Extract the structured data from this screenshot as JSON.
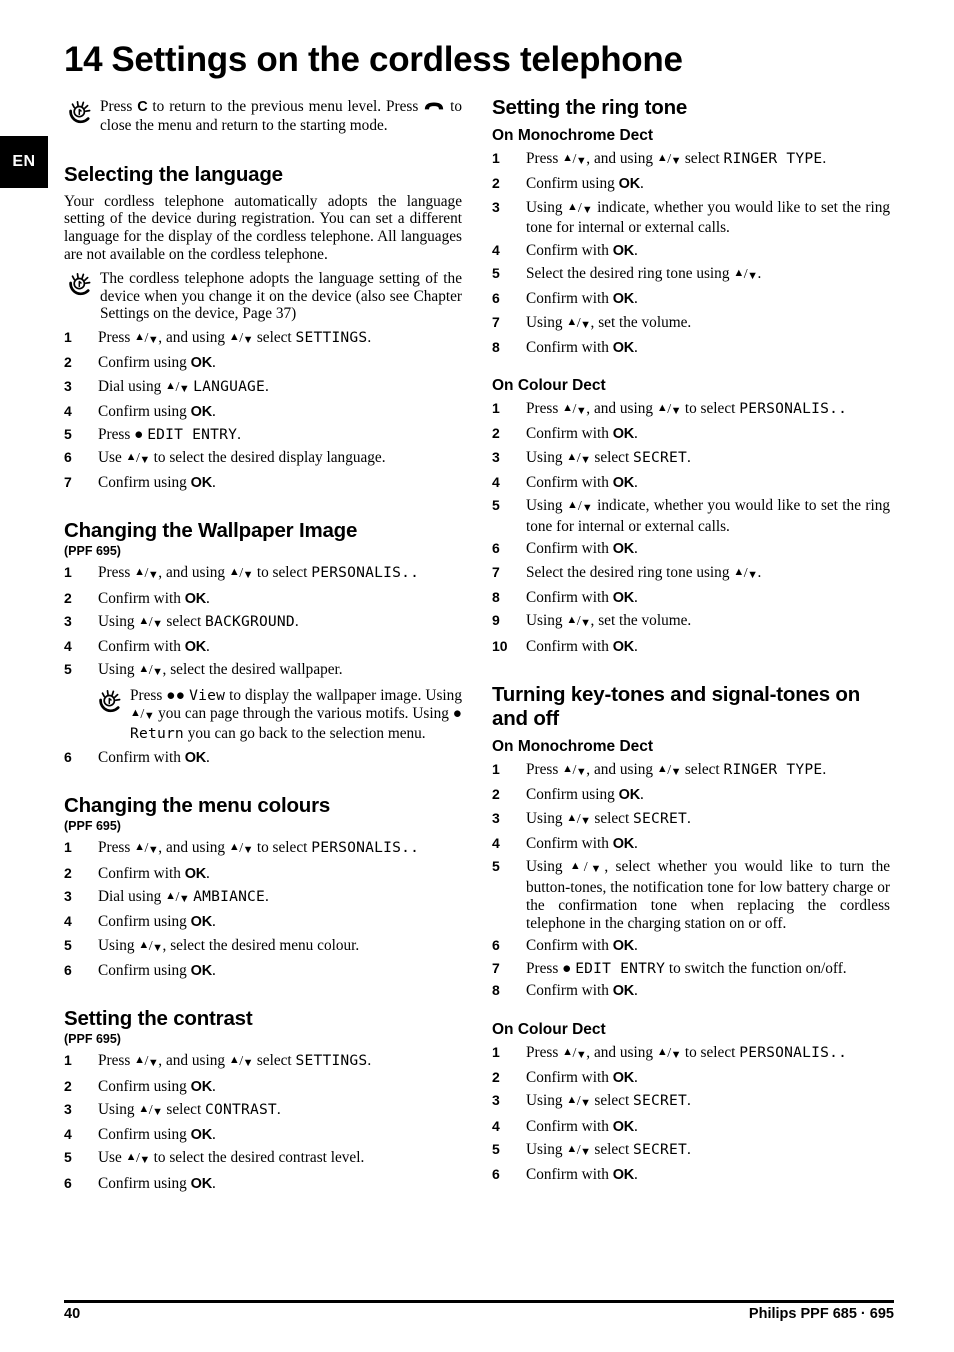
{
  "page": {
    "language_tab": "EN",
    "chapter_number": "14",
    "chapter_title": "Settings on the cordless telephone",
    "footer_page_number": "40",
    "footer_product": "Philips PPF 685 · 695"
  },
  "intro_hint": {
    "text_1": "Press ",
    "key_c": "C",
    "text_2": " to return to the previous menu level. Press ",
    "text_3": " to close the menu and return to the starting mode."
  },
  "left_column": {
    "selecting_language": {
      "heading": "Selecting the language",
      "body": "Your cordless telephone automatically adopts the language setting of the device during registration. You can set a different language for the display of the cordless telephone. All languages are not available on the cordless telephone.",
      "hint": "The cordless telephone adopts the language setting of the device when you change it on the device (also see Chapter Settings on the device, Page 37)",
      "steps": [
        {
          "n": "1",
          "pre": "Press ",
          "mid": ", and using ",
          "post": " select ",
          "lcd": "SETTINGS",
          "tail": "."
        },
        {
          "n": "2",
          "plain_pre": "Confirm using ",
          "key": "OK",
          "tail": "."
        },
        {
          "n": "3",
          "pre": "Dial using ",
          "post": " ",
          "lcd": "LANGUAGE",
          "tail": "."
        },
        {
          "n": "4",
          "plain_pre": "Confirm using ",
          "key": "OK",
          "tail": "."
        },
        {
          "n": "5",
          "plain_pre": "Press ● ",
          "lcd": "EDIT ENTRY",
          "tail": "."
        },
        {
          "n": "6",
          "pre": "Use ",
          "post": " to select the desired display language."
        },
        {
          "n": "7",
          "plain_pre": "Confirm using ",
          "key": "OK",
          "tail": "."
        }
      ]
    },
    "wallpaper": {
      "heading": "Changing the Wallpaper Image",
      "model": "(PPF 695)",
      "steps": [
        {
          "n": "1",
          "pre": "Press ",
          "mid": ", and using ",
          "post": " to select ",
          "lcd": "PERSONALIS..",
          "tail": ""
        },
        {
          "n": "2",
          "plain_pre": "Confirm with ",
          "key": "OK",
          "tail": "."
        },
        {
          "n": "3",
          "pre": "Using ",
          "post": " select ",
          "lcd": "BACKGROUND",
          "tail": "."
        },
        {
          "n": "4",
          "plain_pre": "Confirm with ",
          "key": "OK",
          "tail": "."
        },
        {
          "n": "5",
          "pre": "Using ",
          "post": ", select the desired wallpaper."
        }
      ],
      "hint_1": "Press ●● ",
      "hint_lcd_1": "View",
      "hint_2": " to display the wallpaper image. Using ",
      "hint_3": " you can page through the various motifs. Using ● ",
      "hint_lcd_2": "Return",
      "hint_4": " you can go back to the selection menu.",
      "final_step": {
        "n": "6",
        "plain_pre": "Confirm with ",
        "key": "OK",
        "tail": "."
      }
    },
    "menu_colours": {
      "heading": "Changing the menu colours",
      "model": "(PPF 695)",
      "steps": [
        {
          "n": "1",
          "pre": "Press ",
          "mid": ", and using ",
          "post": " to select ",
          "lcd": "PERSONALIS..",
          "tail": ""
        },
        {
          "n": "2",
          "plain_pre": "Confirm with ",
          "key": "OK",
          "tail": "."
        },
        {
          "n": "3",
          "pre": "Dial using ",
          "post": " ",
          "lcd": "AMBIANCE",
          "tail": "."
        },
        {
          "n": "4",
          "plain_pre": "Confirm using ",
          "key": "OK",
          "tail": "."
        },
        {
          "n": "5",
          "pre": "Using ",
          "post": ", select the desired menu colour."
        },
        {
          "n": "6",
          "plain_pre": "Confirm using ",
          "key": "OK",
          "tail": "."
        }
      ]
    },
    "contrast": {
      "heading": "Setting the contrast",
      "model": "(PPF 695)",
      "steps": [
        {
          "n": "1",
          "pre": "Press ",
          "mid": ", and using ",
          "post": " select ",
          "lcd": "SETTINGS",
          "tail": "."
        },
        {
          "n": "2",
          "plain_pre": "Confirm using ",
          "key": "OK",
          "tail": "."
        },
        {
          "n": "3",
          "pre": "Using ",
          "post": " select ",
          "lcd": "CONTRAST",
          "tail": "."
        },
        {
          "n": "4",
          "plain_pre": "Confirm using ",
          "key": "OK",
          "tail": "."
        },
        {
          "n": "5",
          "pre": "Use ",
          "post": " to select the desired contrast level."
        },
        {
          "n": "6",
          "plain_pre": "Confirm using ",
          "key": "OK",
          "tail": "."
        }
      ]
    }
  },
  "right_column": {
    "ring_tone": {
      "heading": "Setting the ring tone",
      "mono_sub": "On Monochrome Dect",
      "mono_steps": [
        {
          "n": "1",
          "pre": "Press ",
          "mid": ", and using ",
          "post": " select ",
          "lcd": "RINGER TYPE",
          "tail": "."
        },
        {
          "n": "2",
          "plain_pre": "Confirm using ",
          "key": "OK",
          "tail": "."
        },
        {
          "n": "3",
          "pre": "Using ",
          "post": " indicate, whether you would like to set the ring tone for internal or external calls."
        },
        {
          "n": "4",
          "plain_pre": "Confirm with ",
          "key": "OK",
          "tail": "."
        },
        {
          "n": "5",
          "plain_pre": "Select the desired ring tone using ",
          "arrows_after": true,
          "tail": "."
        },
        {
          "n": "6",
          "plain_pre": "Confirm with ",
          "key": "OK",
          "tail": "."
        },
        {
          "n": "7",
          "pre": "Using ",
          "post": ", set the volume."
        },
        {
          "n": "8",
          "plain_pre": "Confirm with ",
          "key": "OK",
          "tail": "."
        }
      ],
      "colour_sub": "On Colour Dect",
      "colour_steps": [
        {
          "n": "1",
          "pre": "Press ",
          "mid": ", and using ",
          "post": " to select ",
          "lcd": "PERSONALIS..",
          "tail": ""
        },
        {
          "n": "2",
          "plain_pre": "Confirm with ",
          "key": "OK",
          "tail": "."
        },
        {
          "n": "3",
          "pre": "Using ",
          "post": " select ",
          "lcd": "SECRET",
          "tail": "."
        },
        {
          "n": "4",
          "plain_pre": "Confirm with ",
          "key": "OK",
          "tail": "."
        },
        {
          "n": "5",
          "pre": "Using ",
          "post": " indicate, whether you would like to set the ring tone for internal or external calls."
        },
        {
          "n": "6",
          "plain_pre": "Confirm with ",
          "key": "OK",
          "tail": "."
        },
        {
          "n": "7",
          "plain_pre": "Select the desired ring tone using ",
          "arrows_after": true,
          "tail": "."
        },
        {
          "n": "8",
          "plain_pre": "Confirm with ",
          "key": "OK",
          "tail": "."
        },
        {
          "n": "9",
          "pre": "Using ",
          "post": ", set the volume."
        },
        {
          "n": "10",
          "plain_pre": "Confirm with ",
          "key": "OK",
          "tail": "."
        }
      ]
    },
    "key_tones": {
      "heading": "Turning key-tones and signal-tones on and off",
      "mono_sub": "On Monochrome Dect",
      "mono_steps": [
        {
          "n": "1",
          "pre": "Press ",
          "mid": ", and using ",
          "post": " select ",
          "lcd": "RINGER TYPE",
          "tail": "."
        },
        {
          "n": "2",
          "plain_pre": "Confirm using ",
          "key": "OK",
          "tail": "."
        },
        {
          "n": "3",
          "pre": "Using ",
          "post": " select ",
          "lcd": "SECRET",
          "tail": "."
        },
        {
          "n": "4",
          "plain_pre": "Confirm with ",
          "key": "OK",
          "tail": "."
        },
        {
          "n": "5",
          "pre": "Using ",
          "post": ", select whether you would like to turn the button-tones, the notification tone for low battery charge or the confirmation tone when replacing the cordless telephone in the charging station on or off."
        },
        {
          "n": "6",
          "plain_pre": "Confirm with ",
          "key": "OK",
          "tail": "."
        },
        {
          "n": "7",
          "plain_pre": "Press ● ",
          "lcd": "EDIT ENTRY",
          "tail": " to switch the function on/off."
        },
        {
          "n": "8",
          "plain_pre": "Confirm with ",
          "key": "OK",
          "tail": "."
        }
      ],
      "colour_sub": "On Colour Dect",
      "colour_steps": [
        {
          "n": "1",
          "pre": "Press ",
          "mid": ", and using ",
          "post": " to select ",
          "lcd": "PERSONALIS..",
          "tail": ""
        },
        {
          "n": "2",
          "plain_pre": "Confirm with ",
          "key": "OK",
          "tail": "."
        },
        {
          "n": "3",
          "pre": "Using ",
          "post": " select ",
          "lcd": "SECRET",
          "tail": "."
        },
        {
          "n": "4",
          "plain_pre": "Confirm with ",
          "key": "OK",
          "tail": "."
        },
        {
          "n": "5",
          "pre": "Using ",
          "post": " select ",
          "lcd": "SECRET",
          "tail": "."
        },
        {
          "n": "6",
          "plain_pre": "Confirm with ",
          "key": "OK",
          "tail": "."
        }
      ]
    }
  },
  "icons": {
    "lightbulb": "lightbulb-hint-icon",
    "handset": "handset-hangup-icon"
  }
}
